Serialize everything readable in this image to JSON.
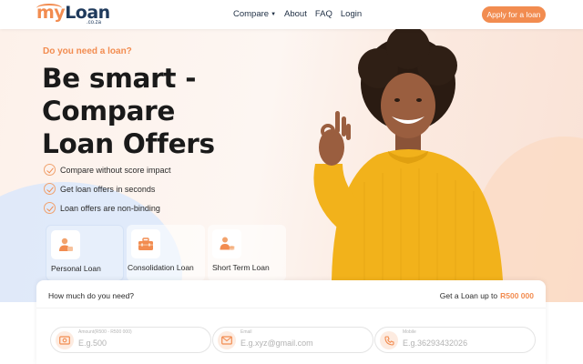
{
  "header": {
    "logo": {
      "my": "my",
      "loan": "Loan",
      "sub": ".co.za"
    },
    "nav": [
      {
        "label": "Compare",
        "has_dropdown": true
      },
      {
        "label": "About"
      },
      {
        "label": "FAQ"
      },
      {
        "label": "Login"
      }
    ],
    "apply_label": "Apply for a loan"
  },
  "hero": {
    "eyebrow": "Do you need a loan?",
    "headline": [
      "Be smart -",
      "Compare",
      "Loan Offers"
    ],
    "bullets": [
      "Compare without score impact",
      "Get loan offers in seconds",
      "Loan offers are non-binding"
    ]
  },
  "loan_types": [
    {
      "label": "Personal Loan",
      "icon": "person-icon",
      "selected": true
    },
    {
      "label": "Consolidation Loan",
      "icon": "briefcase-icon",
      "selected": false
    },
    {
      "label": "Short Term Loan",
      "icon": "person-coins-icon",
      "selected": false
    }
  ],
  "form": {
    "question": "How much do you need?",
    "max_label": "Get a Loan up to",
    "max_amount": "R500 000",
    "fields": [
      {
        "label": "Amount(R500 - R500 000)",
        "placeholder": "E.g.500",
        "icon": "money-icon"
      },
      {
        "label": "Email",
        "placeholder": "E.g.xyz@gmail.com",
        "icon": "mail-icon"
      },
      {
        "label": "Mobile",
        "placeholder": "E.g.36293432026",
        "icon": "phone-icon"
      }
    ]
  },
  "colors": {
    "accent": "#f28c50",
    "navy": "#1f3a5c",
    "sweater": "#f2b21b"
  }
}
